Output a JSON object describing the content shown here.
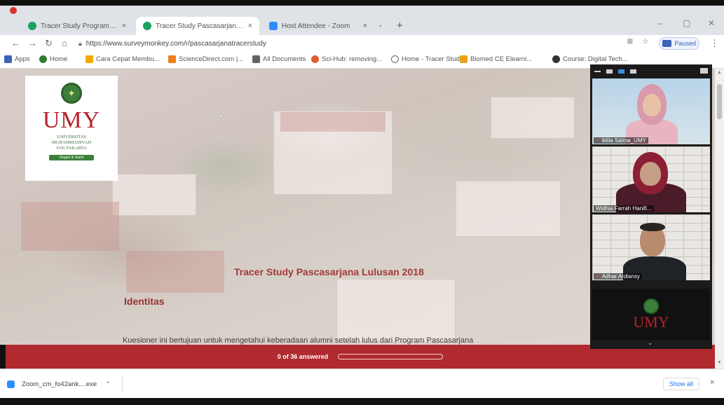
{
  "browser": {
    "tabs": [
      {
        "label": "Tracer Study Program Profesi Li",
        "favicon_color": "#1aa260",
        "active": false
      },
      {
        "label": "Tracer Study Pascasarjana Lulusan",
        "favicon_color": "#1aa260",
        "active": true
      },
      {
        "label": "Host Attendee - Zoom",
        "favicon_color": "#2d8cff",
        "active": false
      }
    ],
    "new_tab": "+",
    "tab_close": "×",
    "tab_dropdown": "⌄",
    "window_controls": {
      "minimize": "–",
      "maximize": "▢",
      "close": "✕"
    },
    "url": "https://www.surveymonkey.com/r/pascasarjanatracerstudy",
    "profile_status": "Paused",
    "bookmarks": [
      {
        "label": "Apps",
        "color": "#3b62b5"
      },
      {
        "label": "Home",
        "color": "#2e7d32"
      },
      {
        "label": "Cara Cepat Membu...",
        "color": "#f2a900"
      },
      {
        "label": "ScienceDirect.com |...",
        "color": "#f07e1a"
      },
      {
        "label": "All Documents",
        "color": "#5f6368"
      },
      {
        "label": "Sci-Hub: removing...",
        "color": "#e35b2c"
      },
      {
        "label": "Home - Tracer Study",
        "color": "#ffffff"
      },
      {
        "label": "Biomed CE Elearni...",
        "color": "#e8a317"
      },
      {
        "label": "Course: Digital Tech...",
        "color": "#333333"
      }
    ]
  },
  "survey": {
    "logo": {
      "word": "UMY",
      "subtitle_line1": "UNIVERSITAS",
      "subtitle_line2": "MUHAMMADIYAH",
      "subtitle_line3": "YOGYAKARTA",
      "ribbon": "Unggul & Islami"
    },
    "title": "Tracer Study Pascasarjana Lulusan 2018",
    "section": "Identitas",
    "intro": "Kuesioner ini bertujuan untuk mengetahui keberadaan alumni setelah lulus dari Program Pascasarjana",
    "progress": {
      "text": "0 of 36 answered",
      "fraction": 0.0
    }
  },
  "zoom": {
    "participants": [
      {
        "name": "Iklila Salma_UMY",
        "mic_muted": true
      },
      {
        "name": "Widhia Farrah Hanifi...",
        "mic_muted": false
      },
      {
        "name": "Adhar Ardiansy",
        "mic_muted": true
      }
    ],
    "shared_logo": "UMY",
    "collapse": "⌄"
  },
  "downloads": {
    "file": "Zoom_cm_fo42ank....exe",
    "show_all": "Show all",
    "close": "×"
  },
  "colors": {
    "brand_red": "#b02a30",
    "title_red": "#a13a3a",
    "umy_green": "#3c7f3a",
    "zoom_blue": "#2d8cff"
  }
}
